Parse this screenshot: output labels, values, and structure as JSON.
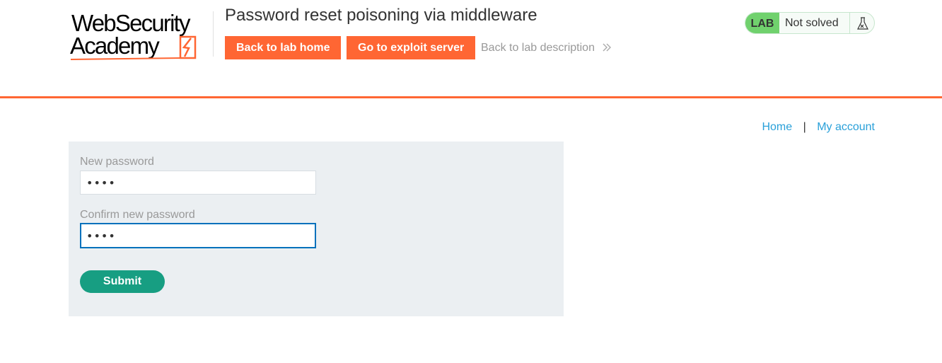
{
  "header": {
    "logo_line1": "WebSecurity",
    "logo_line2": "Academy",
    "lab_title": "Password reset poisoning via middleware",
    "back_to_lab_home": "Back to lab home",
    "go_to_exploit_server": "Go to exploit server",
    "back_to_lab_description": "Back to lab description"
  },
  "status": {
    "badge": "LAB",
    "text": "Not solved",
    "icon": "flask-icon"
  },
  "nav": {
    "home": "Home",
    "separator": "|",
    "my_account": "My account"
  },
  "form": {
    "new_password_label": "New password",
    "new_password_value": "••••",
    "confirm_password_label": "Confirm new password",
    "confirm_password_value": "••••",
    "submit_label": "Submit"
  },
  "colors": {
    "accent_orange": "#ff6633",
    "lab_green": "#70d16d",
    "submit_teal": "#179e82",
    "link_blue": "#29a0d9",
    "focus_blue": "#0071bc",
    "panel_grey": "#ebeff2"
  }
}
